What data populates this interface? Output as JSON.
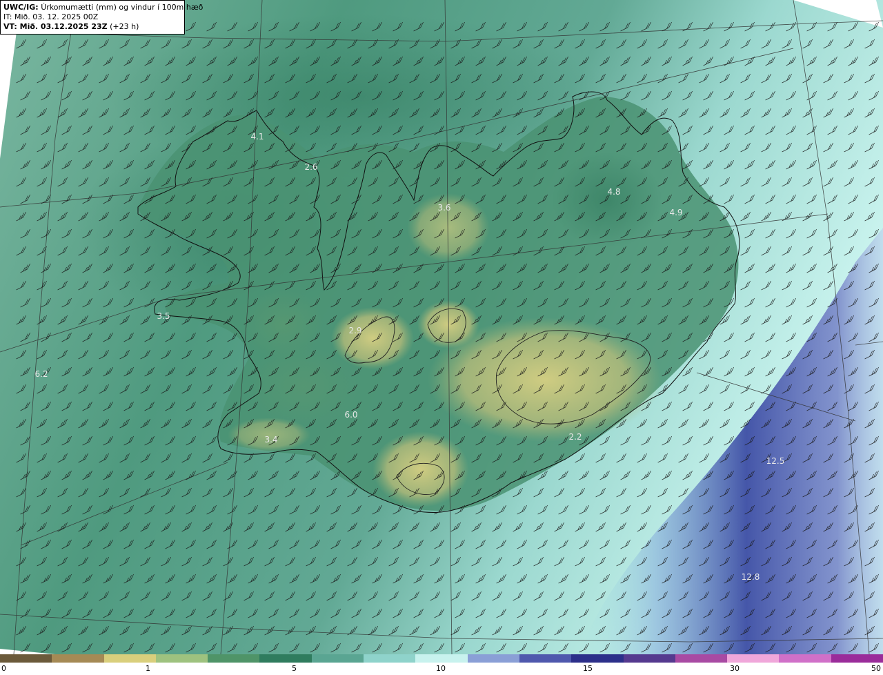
{
  "header": {
    "model": "UWC/IG:",
    "product": "Úrkomumætti (mm) og vindur í 100m hæð",
    "it_line": "IT: Mið. 03. 12. 2025 00Z",
    "vt_prefix": "VT: Mið. 03.12.2025 23Z",
    "vt_suffix": "(+23 h)"
  },
  "map_labels": [
    {
      "id": "wfjords-north",
      "text": "4.1"
    },
    {
      "id": "west-fjords-east",
      "text": "2.6"
    },
    {
      "id": "north-central",
      "text": "3.6"
    },
    {
      "id": "northeast-1",
      "text": "4.8"
    },
    {
      "id": "northeast-2",
      "text": "4.9"
    },
    {
      "id": "snaefellsnes",
      "text": "3.5"
    },
    {
      "id": "langjokull",
      "text": "2.9"
    },
    {
      "id": "offshore-west",
      "text": "6.2"
    },
    {
      "id": "south-interior",
      "text": "6.0"
    },
    {
      "id": "reykjanes",
      "text": "3.4"
    },
    {
      "id": "vatnajokull-south",
      "text": "2.2"
    },
    {
      "id": "offshore-southeast",
      "text": "12.5"
    },
    {
      "id": "offshore-south",
      "text": "12.8"
    }
  ],
  "colorbar": {
    "ticks": [
      "0",
      "1",
      "5",
      "10",
      "15",
      "30",
      "50"
    ],
    "colors": [
      "#6b5a3a",
      "#a58a55",
      "#d9cf7c",
      "#9ec27f",
      "#4f9468",
      "#2f7c5e",
      "#5aa592",
      "#8fd3cb",
      "#c8f2ee",
      "#8a9fd6",
      "#4f58ad",
      "#2c2f8a",
      "#55398f",
      "#a84aa3",
      "#f0a7da",
      "#d070c8",
      "#9a2c9a"
    ]
  }
}
